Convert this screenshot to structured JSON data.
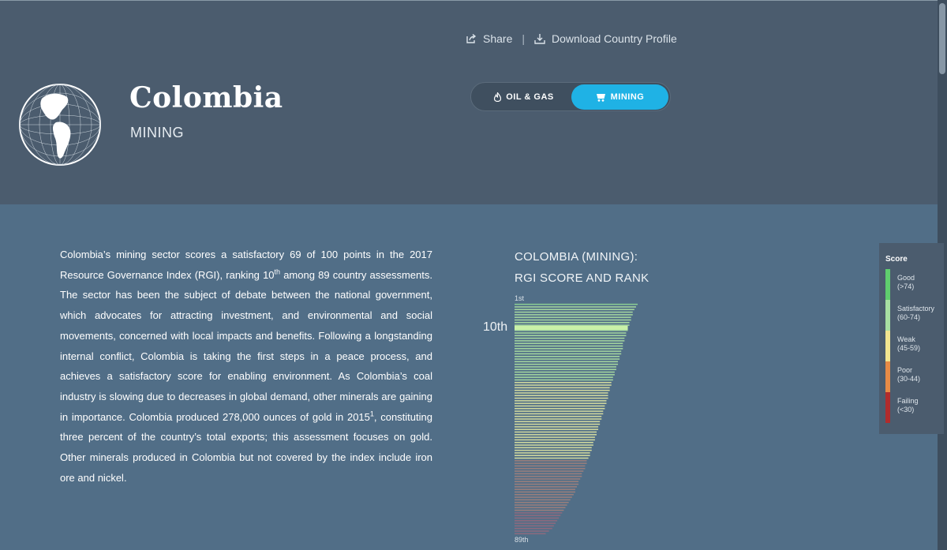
{
  "header": {
    "country": "Colombia",
    "sector": "MINING",
    "share_label": "Share",
    "download_label": "Download Country Profile",
    "tabs": [
      {
        "label": "OIL & GAS",
        "active": false
      },
      {
        "label": "MINING",
        "active": true
      }
    ]
  },
  "intro": {
    "p1": "Colombia’s mining sector scores a satisfactory 69 of 100 points in the 2017 Resource Governance Index (RGI), ranking 10",
    "sup1": "th",
    "p2": " among 89 country assessments. The sector has been the subject of debate between the national government, which advocates for attracting investment, and environmental and social movements, concerned with local impacts and benefits. Following a longstanding internal conflict, Colombia is taking the first steps in a peace process, and achieves a satisfactory score for enabling environment. As Colombia’s coal industry is slowing due to decreases in global demand, other minerals are gaining in importance. Colombia produced 278,000 ounces of gold in 2015",
    "sup2": "1",
    "p3": ", constituting three percent of the country’s total exports; this assessment focuses on gold. Other minerals produced in Colombia but not covered by the index include iron ore and nickel."
  },
  "chart_data": {
    "type": "bar",
    "title_line1": "COLOMBIA (MINING):",
    "title_line2": "RGI SCORE AND RANK",
    "rank_top_label": "1st",
    "rank_bottom_label": "89th",
    "highlight_label": "10th",
    "highlight_rank": 10,
    "highlight_score": 69,
    "num_countries": 89,
    "score_range": [
      0,
      100
    ],
    "scores": [
      75,
      74,
      73,
      72,
      72,
      71,
      71,
      70,
      70,
      69,
      69,
      68,
      68,
      67,
      67,
      66,
      66,
      66,
      65,
      65,
      64,
      64,
      63,
      63,
      62,
      62,
      61,
      61,
      60,
      60,
      59,
      59,
      58,
      58,
      57,
      57,
      57,
      56,
      56,
      55,
      55,
      54,
      54,
      53,
      53,
      52,
      52,
      51,
      51,
      50,
      50,
      49,
      49,
      48,
      48,
      47,
      47,
      46,
      46,
      45,
      44,
      44,
      43,
      43,
      42,
      41,
      41,
      40,
      39,
      39,
      38,
      37,
      37,
      36,
      35,
      34,
      33,
      32,
      31,
      30,
      29,
      28,
      27,
      26,
      25,
      24,
      23,
      21,
      19
    ],
    "colors": {
      "good": "#8ccf94",
      "satisfactory": "#a7d9a0",
      "weak": "#d5dc9f",
      "poor": "#9c7f7c",
      "failing": "#8e6a7e",
      "highlight": "#c9f1a8"
    }
  },
  "legend": {
    "title": "Score",
    "items": [
      {
        "line1": "Good",
        "line2": "(>74)",
        "color": "#5fce6e"
      },
      {
        "line1": "Satisfactory",
        "line2": "(60-74)",
        "color": "#a8dfa2"
      },
      {
        "line1": "Weak",
        "line2": "(45-59)",
        "color": "#f2e58f"
      },
      {
        "line1": "Poor",
        "line2": "(30-44)",
        "color": "#e88b46"
      },
      {
        "line1": "Failing",
        "line2": "(<30)",
        "color": "#b12c2c"
      }
    ]
  }
}
